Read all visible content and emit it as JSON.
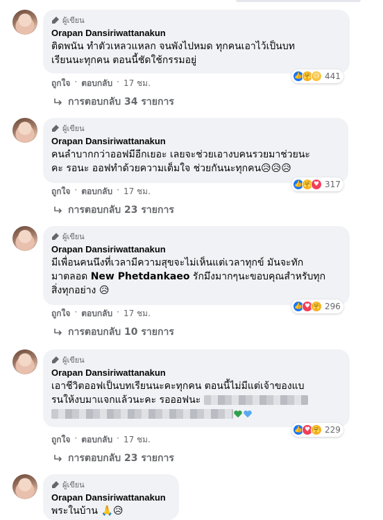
{
  "colors": {
    "bubble_bg": "#f0f2f5",
    "muted": "#65676b",
    "like": "#1877f2",
    "love": "#f33e58",
    "care": "#f7b125"
  },
  "comments": [
    {
      "badge": "ผู้เขียน",
      "author": "Orapan Dansiriwattanakun",
      "text": "ติดพนัน ทำตัวเหลวแหลก จนพังไปหมด ทุกคนเอาไว้เป็นบท\nเรียนนะทุกคน ตอนนี้ชัดใช้กรรมอยู่",
      "reactions": [
        "like-icon",
        "care-icon",
        "sad-icon"
      ],
      "reaction_count": "441",
      "like": "ถูกใจ",
      "reply": "ตอบกลับ",
      "time": "17 ชม.",
      "replies": "การตอบกลับ 34 รายการ"
    },
    {
      "badge": "ผู้เขียน",
      "author": "Orapan Dansiriwattanakun",
      "text": "คนลำบากกว่าออฟมีอีกเยอะ เลยจะช่วยเอางบคนรวยมาช่วยนะ\nคะ รอนะ ออฟทำด้วยความเต็มใจ ช่วยกันนะทุกคน😥😥😥",
      "reactions": [
        "like-icon",
        "care-icon",
        "love-icon"
      ],
      "reaction_count": "317",
      "like": "ถูกใจ",
      "reply": "ตอบกลับ",
      "time": "17 ชม.",
      "replies": "การตอบกลับ 23 รายการ"
    },
    {
      "badge": "ผู้เขียน",
      "author": "Orapan Dansiriwattanakun",
      "text": "มีเพื่อนคนนึงที่เวลามีความสุขจะไม่เห็นแต่เวลาทุกข์ มันจะทัก\nมาตลอด ",
      "mention": "New Phetdankaeo",
      "text_after": " รักมึงมากๆนะขอบคุณสำหรับทุก\nสิ่งทุกอย่าง 😥",
      "reactions": [
        "like-icon",
        "love-icon",
        "care-icon"
      ],
      "reaction_count": "296",
      "like": "ถูกใจ",
      "reply": "ตอบกลับ",
      "time": "17 ชม.",
      "replies": "การตอบกลับ 10 รายการ"
    },
    {
      "badge": "ผู้เขียน",
      "author": "Orapan Dansiriwattanakun",
      "text": "เอาชีวิตออฟเป็นบทเรียนนะคะทุกคน ตอนนี้ไม่มีแต่เจ้าของแบ\nรนให้งบมาแจกแล้วนะคะ รอออฟนะ",
      "reactions": [
        "like-icon",
        "love-icon",
        "care-icon"
      ],
      "reaction_count": "229",
      "like": "ถูกใจ",
      "reply": "ตอบกลับ",
      "time": "17 ชม.",
      "replies": "การตอบกลับ 23 รายการ"
    },
    {
      "badge": "ผู้เขียน",
      "author": "Orapan Dansiriwattanakun",
      "text": "พระในบ้าน 🙏😥"
    }
  ]
}
